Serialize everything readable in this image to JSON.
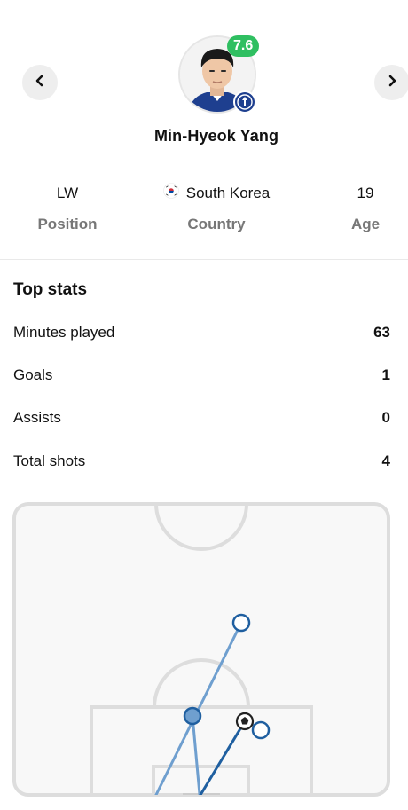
{
  "player": {
    "name": "Min-Hyeok Yang",
    "rating": "7.6",
    "position_value": "LW",
    "position_label": "Position",
    "country_value": "South Korea",
    "country_label": "Country",
    "age_value": "19",
    "age_label": "Age"
  },
  "nav": {
    "prev_icon": "chevron-left-icon",
    "next_icon": "chevron-right-icon"
  },
  "top_stats": {
    "title": "Top stats",
    "rows": [
      {
        "label": "Minutes played",
        "value": "63"
      },
      {
        "label": "Goals",
        "value": "1"
      },
      {
        "label": "Assists",
        "value": "0"
      },
      {
        "label": "Total shots",
        "value": "4"
      }
    ]
  },
  "shot_map": {
    "shots": [
      {
        "type": "miss"
      },
      {
        "type": "blocked"
      },
      {
        "type": "goal"
      },
      {
        "type": "miss"
      }
    ]
  },
  "colors": {
    "rating_green": "#2fbf61",
    "shot_blue": "#1f5fa0",
    "shot_light_blue": "#6f9fcf",
    "pitch_line": "#dddddd",
    "pitch_bg": "#f8f8f8"
  }
}
